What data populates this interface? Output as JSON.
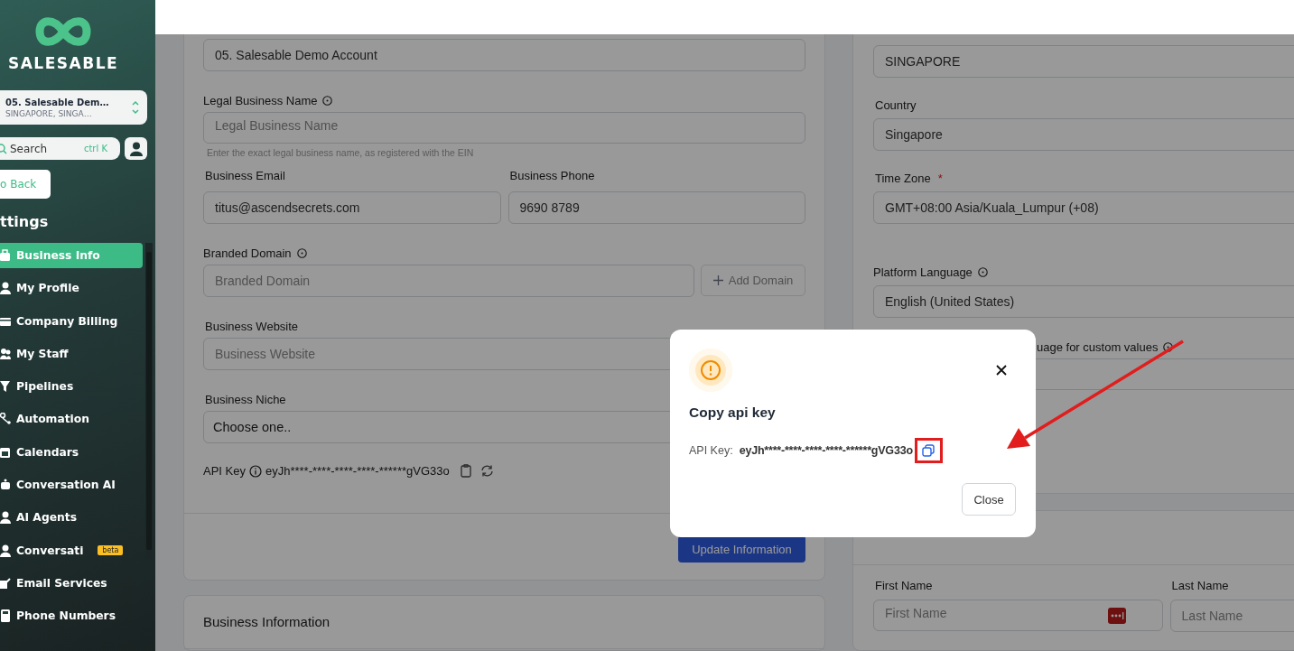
{
  "sidebar": {
    "brand": "SALESABLE",
    "account": {
      "name": "05. Salesable Dem…",
      "location": "SINGAPORE, SINGA…"
    },
    "search": {
      "placeholder": "Search",
      "shortcut": "ctrl K"
    },
    "back_button": "o Back",
    "section_title": "ttings",
    "items": [
      {
        "label": "Business Info",
        "selected": true
      },
      {
        "label": "My Profile",
        "selected": false
      },
      {
        "label": "Company Billing",
        "selected": false
      },
      {
        "label": "My Staff",
        "selected": false
      },
      {
        "label": "Pipelines",
        "selected": false
      },
      {
        "label": "Automation",
        "selected": false
      },
      {
        "label": "Calendars",
        "selected": false
      },
      {
        "label": "Conversation AI",
        "selected": false
      },
      {
        "label": "AI Agents",
        "selected": false
      },
      {
        "label": "Conversati",
        "selected": false,
        "badge": "beta"
      },
      {
        "label": "Email Services",
        "selected": false
      },
      {
        "label": "Phone Numbers",
        "selected": false
      }
    ]
  },
  "business_form": {
    "account_name": {
      "value": "05. Salesable Demo Account"
    },
    "legal_name": {
      "label": "Legal Business Name",
      "placeholder": "Legal Business Name",
      "hint": "Enter the exact legal business name, as registered with the EIN"
    },
    "email": {
      "label": "Business Email",
      "value": "titus@ascendsecrets.com"
    },
    "phone": {
      "label": "Business Phone",
      "value": "9690 8789"
    },
    "branded_domain": {
      "label": "Branded Domain",
      "placeholder": "Branded Domain",
      "add_button": "Add Domain"
    },
    "website": {
      "label": "Business Website",
      "placeholder": "Business Website"
    },
    "niche": {
      "label": "Business Niche",
      "value": "Choose one.."
    },
    "api_key": {
      "label": "API Key",
      "value": "eyJh****-****-****-****-******gVG33o"
    },
    "update_button": "Update Information"
  },
  "business_information_card": {
    "title": "Business Information"
  },
  "address_form": {
    "state": {
      "value": "SINGAPORE"
    },
    "country": {
      "label": "Country",
      "value": "Singapore"
    },
    "time_zone": {
      "label": "Time Zone",
      "required_mark": "*",
      "value": "GMT+08:00 Asia/Kuala_Lumpur (+08)"
    },
    "platform_language": {
      "label": "Platform Language",
      "value": "English (United States)"
    },
    "custom_values_language": {
      "label": "uage for custom values"
    }
  },
  "representative_card": {
    "first_name": {
      "label": "First Name",
      "placeholder": "First Name"
    },
    "last_name": {
      "label": "Last Name",
      "placeholder": "Last Name"
    }
  },
  "modal": {
    "title": "Copy api key",
    "key_label": "API Key:",
    "key_value": "eyJh****-****-****-****-******gVG33o",
    "close_button": "Close"
  }
}
